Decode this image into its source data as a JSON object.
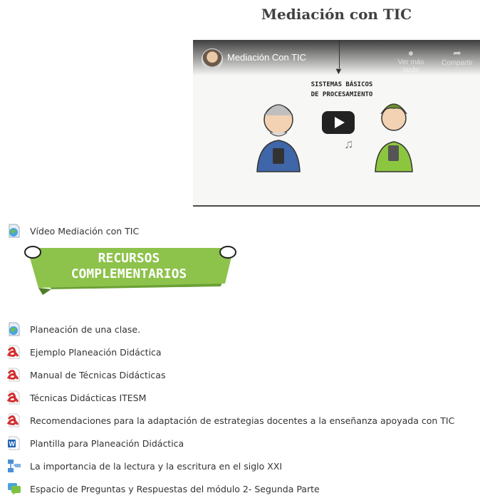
{
  "section_title": "Mediación con TIC",
  "video": {
    "title": "Mediación Con TIC",
    "watch_later": "Ver más tarde",
    "share": "Compartir",
    "caption_line1": "SISTEMAS BÁSICOS",
    "caption_line2": "DE PROCESAMIENTO"
  },
  "banner": {
    "line1": "RECURSOS",
    "line2": "COMPLEMENTARIOS"
  },
  "links": [
    {
      "label": "Vídeo Mediación con TIC",
      "icon": "url-icon"
    },
    {
      "label": "Planeación de una clase.",
      "icon": "url-icon"
    },
    {
      "label": "Ejemplo Planeación Didáctica",
      "icon": "pdf-icon"
    },
    {
      "label": "Manual de Técnicas Didácticas",
      "icon": "pdf-icon"
    },
    {
      "label": "Técnicas Didácticas ITESM",
      "icon": "pdf-icon"
    },
    {
      "label": "Recomendaciones para la adaptación de estrategias docentes a la enseñanza apoyada con TIC",
      "icon": "pdf-icon"
    },
    {
      "label": "Plantilla para Planeación Didáctica",
      "icon": "word-icon"
    },
    {
      "label": "La importancia de la lectura y la escritura en el siglo XXI",
      "icon": "mindmap-icon"
    },
    {
      "label": "Espacio de Preguntas y Respuestas del módulo 2- Segunda Parte",
      "icon": "forum-icon"
    }
  ],
  "colors": {
    "banner_green": "#7cb342",
    "pdf_red": "#d32f2f",
    "word_blue": "#1e63b5",
    "forum_green": "#7cc242"
  }
}
